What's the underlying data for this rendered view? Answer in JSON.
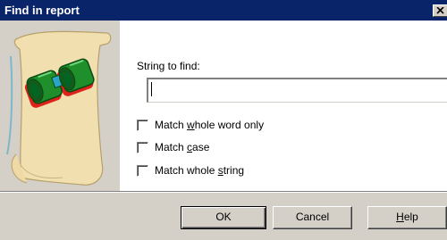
{
  "window": {
    "title": "Find in report"
  },
  "find": {
    "label": "String to find:",
    "value": ""
  },
  "options": [
    {
      "pre": "Match ",
      "acc": "w",
      "post": "hole word only",
      "checked": false
    },
    {
      "pre": "Match ",
      "acc": "c",
      "post": "ase",
      "checked": false
    },
    {
      "pre": "Match whole ",
      "acc": "s",
      "post": "tring",
      "checked": false
    }
  ],
  "buttons": {
    "ok": "OK",
    "cancel": "Cancel",
    "help_acc": "H",
    "help_rest": "elp"
  },
  "illustration": {
    "icon": "binoculars-on-scroll-icon"
  },
  "colors": {
    "titlebar": "#0a246a",
    "face": "#d4d0c8",
    "content": "#ffffff"
  }
}
